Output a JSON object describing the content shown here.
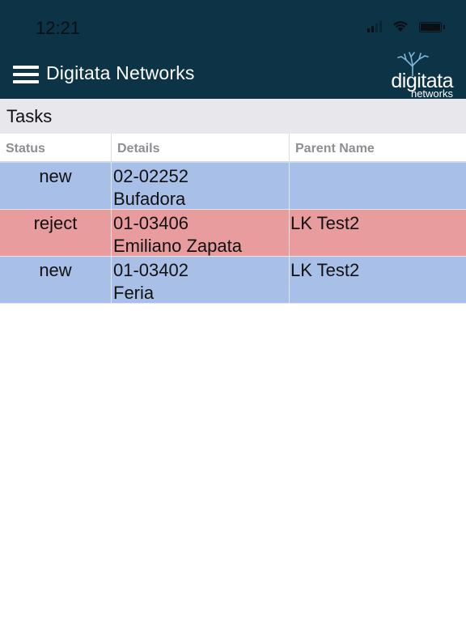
{
  "status_bar": {
    "time": "12:21"
  },
  "header": {
    "title": "Digitata Networks",
    "logo_text": "digitata",
    "logo_subtext": "networks",
    "bg_color": "#0c3346"
  },
  "section": {
    "title": "Tasks"
  },
  "table": {
    "columns": [
      "Status",
      "Details",
      "Parent Name"
    ],
    "rows": [
      {
        "status": "new",
        "details_id": "02-02252",
        "details_name": "Bufadora",
        "parent": "",
        "color": "#a8c0e8"
      },
      {
        "status": "reject",
        "details_id": "01-03406",
        "details_name": "Emiliano Zapata",
        "parent": "LK Test2",
        "color": "#e89c9e"
      },
      {
        "status": "new",
        "details_id": "01-03402",
        "details_name": "Feria",
        "parent": "LK Test2",
        "color": "#a8c0e8"
      }
    ]
  }
}
